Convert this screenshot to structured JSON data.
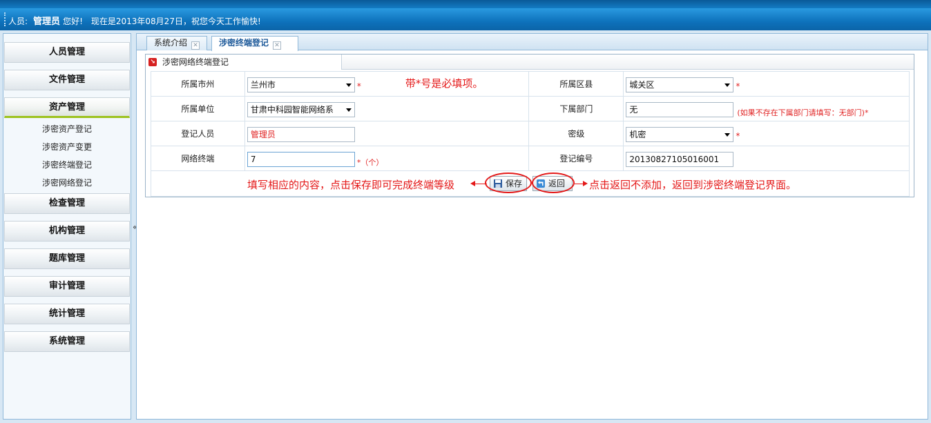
{
  "header": {
    "user_label": "人员:",
    "user_name": "管理员",
    "hello": "您好!",
    "datetime_text": "现在是2013年08月27日，祝您今天工作愉快!"
  },
  "sidebar": {
    "collapse_glyph": "«",
    "menus": [
      {
        "label": "人员管理"
      },
      {
        "label": "文件管理"
      },
      {
        "label": "资产管理",
        "active": true,
        "items": [
          {
            "label": "涉密资产登记"
          },
          {
            "label": "涉密资产变更"
          },
          {
            "label": "涉密终端登记"
          },
          {
            "label": "涉密网络登记"
          }
        ]
      },
      {
        "label": "检查管理"
      },
      {
        "label": "机构管理"
      },
      {
        "label": "题库管理"
      },
      {
        "label": "审计管理"
      },
      {
        "label": "统计管理"
      },
      {
        "label": "系统管理"
      }
    ]
  },
  "tabs": [
    {
      "label": "系统介绍",
      "active": false
    },
    {
      "label": "涉密终端登记",
      "active": true
    }
  ],
  "panel": {
    "title": "涉密网络终端登记"
  },
  "form": {
    "city_label": "所属市州",
    "city_value": "兰州市",
    "county_label": "所属区县",
    "county_value": "城关区",
    "unit_label": "所属单位",
    "unit_value": "甘肃中科园智能网络系",
    "dept_label": "下属部门",
    "dept_value": "无",
    "dept_note": "(如果不存在下属部门请填写：无部门)*",
    "registrant_label": "登记人员",
    "registrant_value": "管理员",
    "secret_label": "密级",
    "secret_value": "机密",
    "terminal_label": "网络终端",
    "terminal_value": "7",
    "terminal_unit": "*（个）",
    "regno_label": "登记编号",
    "regno_value": "20130827105016001",
    "required_star": "*",
    "save_label": "保存",
    "back_label": "返回"
  },
  "annotations": {
    "required_note": "带*号是必填项。",
    "save_note": "填写相应的内容，点击保存即可完成终端等级",
    "back_note": "点击返回不添加，返回到涉密终端登记界面。"
  },
  "colors": {
    "header_blue": "#0e72bc",
    "annotation_red": "#e41818",
    "active_menu_underline": "#9cc21b"
  }
}
